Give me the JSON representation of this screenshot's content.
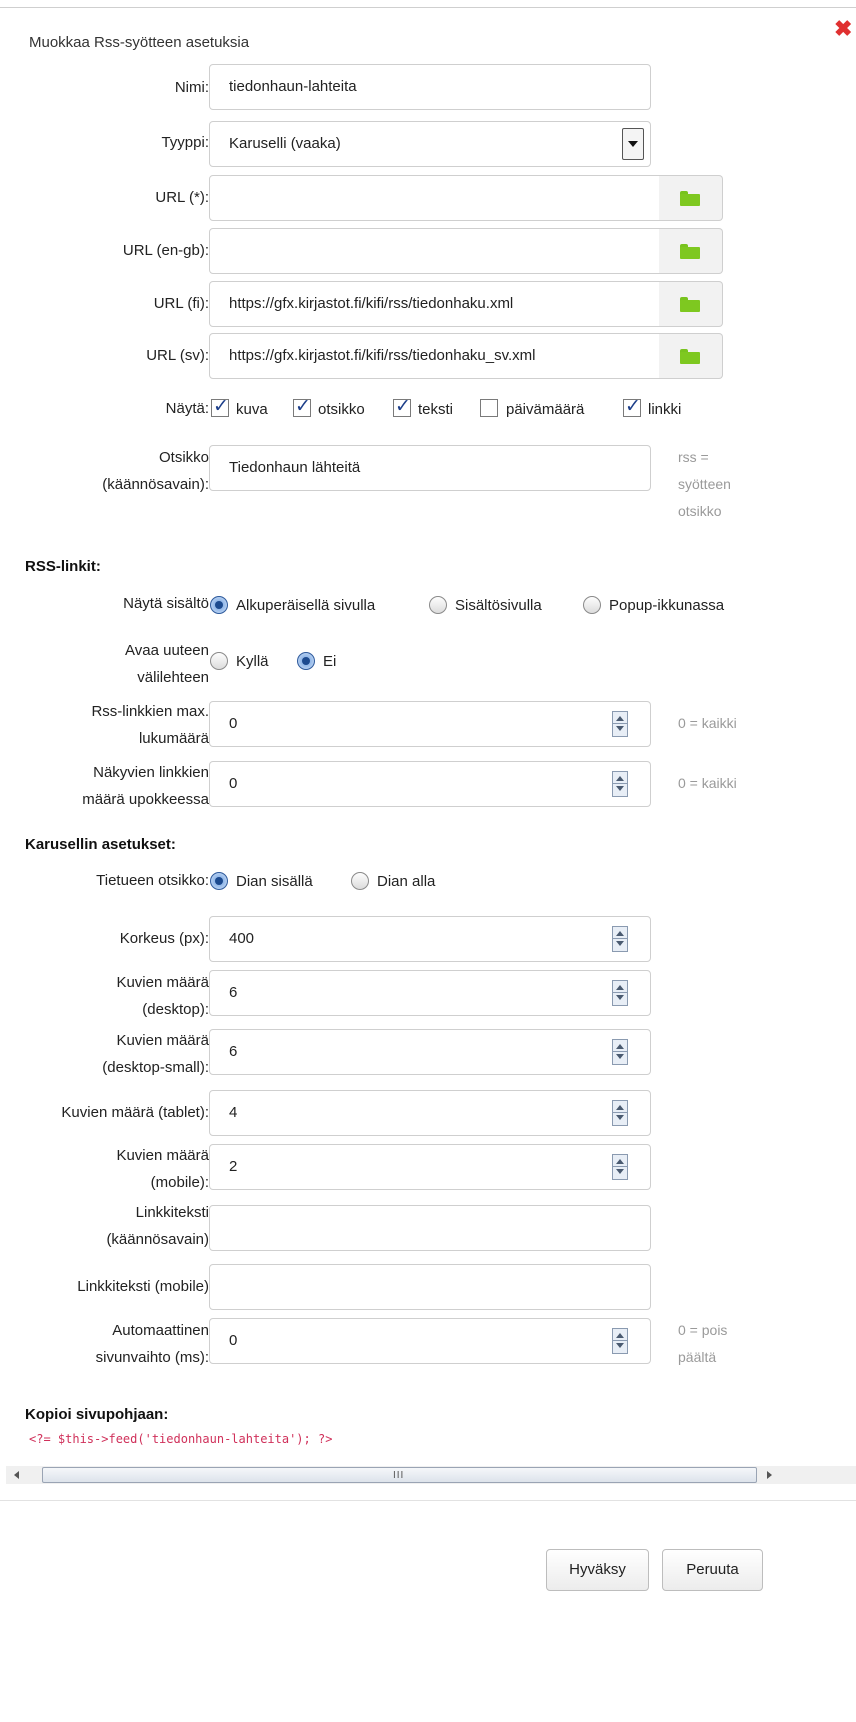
{
  "dialog": {
    "title": "Muokkaa Rss-syötteen asetuksia",
    "close_glyph": "✖"
  },
  "fields": {
    "name": {
      "label": "Nimi:",
      "value": "tiedonhaun-lahteita"
    },
    "type": {
      "label": "Tyyppi:",
      "value": "Karuselli (vaaka)"
    },
    "url_default": {
      "label": "URL (*):",
      "value": ""
    },
    "url_en": {
      "label": "URL (en-gb):",
      "value": ""
    },
    "url_fi": {
      "label": "URL (fi):",
      "value": "https://gfx.kirjastot.fi/kifi/rss/tiedonhaku.xml"
    },
    "url_sv": {
      "label": "URL (sv):",
      "value": "https://gfx.kirjastot.fi/kifi/rss/tiedonhaku_sv.xml"
    },
    "show": {
      "label": "Näytä:",
      "options": [
        {
          "label": "kuva",
          "checked": true
        },
        {
          "label": "otsikko",
          "checked": true
        },
        {
          "label": "teksti",
          "checked": true
        },
        {
          "label": "päivämäärä",
          "checked": false
        },
        {
          "label": "linkki",
          "checked": true
        }
      ]
    },
    "title_key": {
      "label_line1": "Otsikko",
      "label_line2": "(käännösavain):",
      "value": "Tiedonhaun lähteitä",
      "hint_line1": "rss =",
      "hint_line2": "syötteen",
      "hint_line3": "otsikko"
    }
  },
  "rss_links": {
    "section_title": "RSS-linkit:",
    "show_content": {
      "label": "Näytä sisältö",
      "options": [
        {
          "label": "Alkuperäisellä sivulla",
          "selected": true
        },
        {
          "label": "Sisältösivulla",
          "selected": false
        },
        {
          "label": "Popup-ikkunassa",
          "selected": false
        }
      ]
    },
    "new_tab": {
      "label_line1": "Avaa uuteen",
      "label_line2": "välilehteen",
      "options": [
        {
          "label": "Kyllä",
          "selected": false
        },
        {
          "label": "Ei",
          "selected": true
        }
      ]
    },
    "max_links": {
      "label_line1": "Rss-linkkien max.",
      "label_line2": "lukumäärä",
      "value": "0",
      "hint": "0 = kaikki"
    },
    "popup_links": {
      "label_line1": "Näkyvien linkkien",
      "label_line2": "määrä upokkeessa",
      "value": "0",
      "hint": "0 = kaikki"
    }
  },
  "carousel": {
    "section_title": "Karusellin asetukset:",
    "record_title": {
      "label": "Tietueen otsikko:",
      "options": [
        {
          "label": "Dian sisällä",
          "selected": true
        },
        {
          "label": "Dian alla",
          "selected": false
        }
      ]
    },
    "height": {
      "label": "Korkeus (px):",
      "value": "400"
    },
    "count_desktop": {
      "label_line1": "Kuvien määrä",
      "label_line2": "(desktop):",
      "value": "6"
    },
    "count_desktop_small": {
      "label_line1": "Kuvien määrä",
      "label_line2": "(desktop-small):",
      "value": "6"
    },
    "count_tablet": {
      "label": "Kuvien määrä (tablet):",
      "value": "4"
    },
    "count_mobile": {
      "label_line1": "Kuvien määrä",
      "label_line2": "(mobile):",
      "value": "2"
    },
    "link_text": {
      "label_line1": "Linkkiteksti",
      "label_line2": "(käännösavain)",
      "value": ""
    },
    "link_text_mobile": {
      "label": "Linkkiteksti (mobile)",
      "value": ""
    },
    "autoplay": {
      "label_line1": "Automaattinen",
      "label_line2": "sivunvaihto (ms):",
      "value": "0",
      "hint_line1": "0 = pois",
      "hint_line2": "päältä"
    }
  },
  "copy": {
    "section_title": "Kopioi sivupohjaan:",
    "code": "<?= $this->feed('tiedonhaun-lahteita'); ?>"
  },
  "scrollbar": {
    "grip": "III"
  },
  "buttons": {
    "accept": "Hyväksy",
    "cancel": "Peruuta"
  }
}
